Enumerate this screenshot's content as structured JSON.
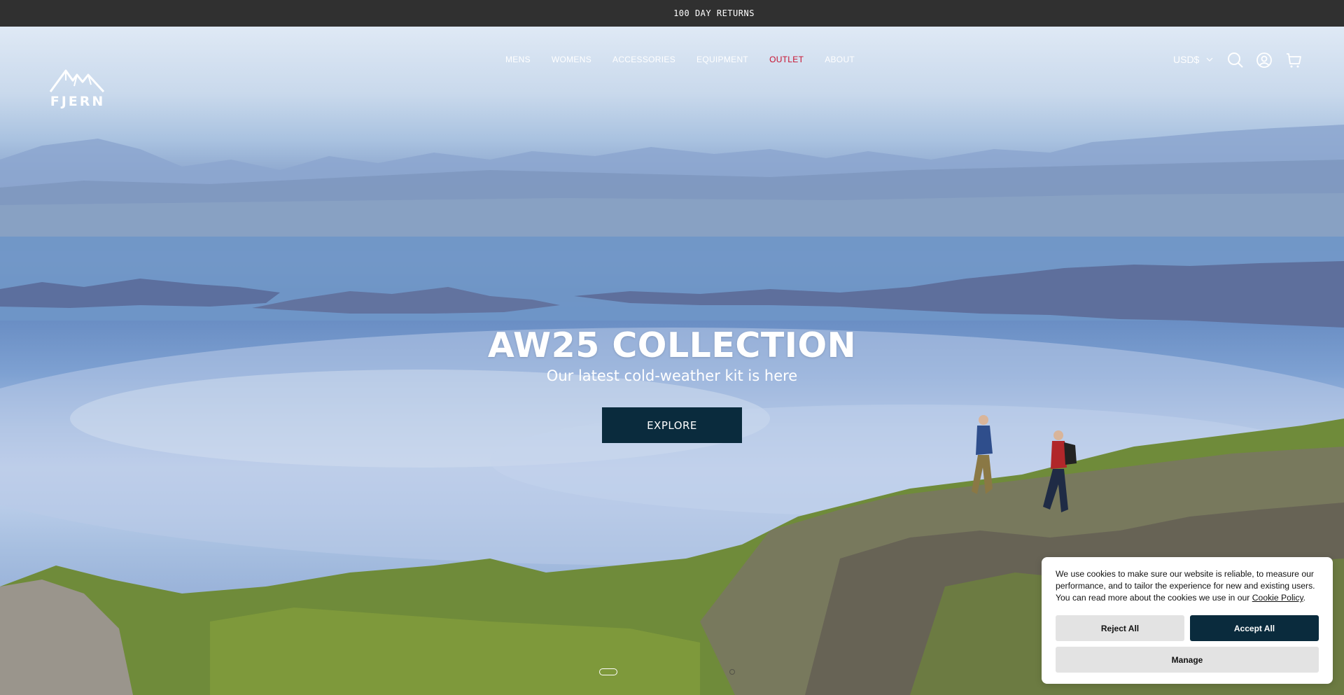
{
  "announcement": {
    "text": "100 DAY RETURNS"
  },
  "header": {
    "logo_text": "FJERN",
    "nav": [
      {
        "label": "MENS"
      },
      {
        "label": "WOMENS"
      },
      {
        "label": "ACCESSORIES"
      },
      {
        "label": "EQUIPMENT"
      },
      {
        "label": "OUTLET",
        "color": "#c8102e"
      },
      {
        "label": "ABOUT"
      }
    ],
    "currency": "USD$",
    "icons": [
      "search-icon",
      "account-icon",
      "cart-icon"
    ]
  },
  "hero": {
    "title": "AW25 COLLECTION",
    "subtitle": "Our latest cold-weather kit is here",
    "cta": "EXPLORE",
    "cta_color": "#0a2b3d"
  },
  "cookie_banner": {
    "text": "We use cookies to make sure our website is reliable, to measure our performance, and to tailor the experience for new and existing users. You can read more about the cookies we use in our",
    "link": "Cookie Policy",
    "after_link": ".",
    "reject": "Reject All",
    "accept": "Accept All",
    "manage": "Manage"
  }
}
